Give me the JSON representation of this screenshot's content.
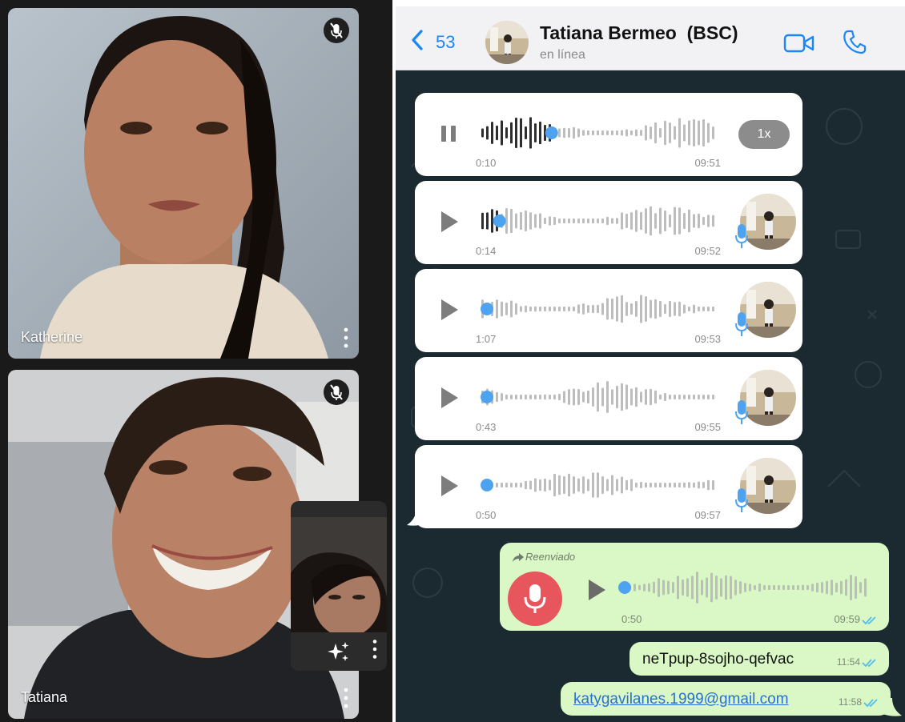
{
  "call": {
    "participants": [
      {
        "name": "Katherine",
        "muted": true
      },
      {
        "name": "Tatiana",
        "muted": true
      }
    ],
    "icons": [
      "mic-off-icon",
      "more-vert-icon",
      "sparkle-effects-icon"
    ]
  },
  "chat": {
    "header": {
      "back_count": "53",
      "contact_name": "Tatiana Bermeo  (BSC)",
      "status": "en línea"
    },
    "colors": {
      "accent": "#1987f5",
      "wave_played": "#2e2e2e",
      "wave_unplayed": "#bdbdbd",
      "outgoing_bubble": "#daf8c5",
      "incoming_bubble": "#ffffff",
      "mic_blue": "#4ea3f1",
      "record_red": "#e7565d",
      "ticks": "#53bdeb"
    },
    "voice_notes": [
      {
        "state": "playing",
        "elapsed": "0:10",
        "time": "09:51",
        "speed": "1x",
        "progress": 0.3
      },
      {
        "state": "paused",
        "elapsed": "0:14",
        "time": "09:52",
        "progress": 0.08
      },
      {
        "state": "paused",
        "elapsed": "1:07",
        "time": "09:53",
        "progress": 0.0
      },
      {
        "state": "paused",
        "elapsed": "0:43",
        "time": "09:55",
        "progress": 0.0
      },
      {
        "state": "paused",
        "elapsed": "0:50",
        "time": "09:57",
        "progress": 0.0
      }
    ],
    "forwarded_note": {
      "label": "Reenviado",
      "duration": "0:50",
      "time": "09:59",
      "progress": 0.0
    },
    "text_messages": [
      {
        "text": "neTpup-8sojho-qefvac",
        "time": "11:54"
      },
      {
        "text": "katygavilanes.1999@gmail.com",
        "time": "11:58",
        "is_link": true
      }
    ]
  }
}
